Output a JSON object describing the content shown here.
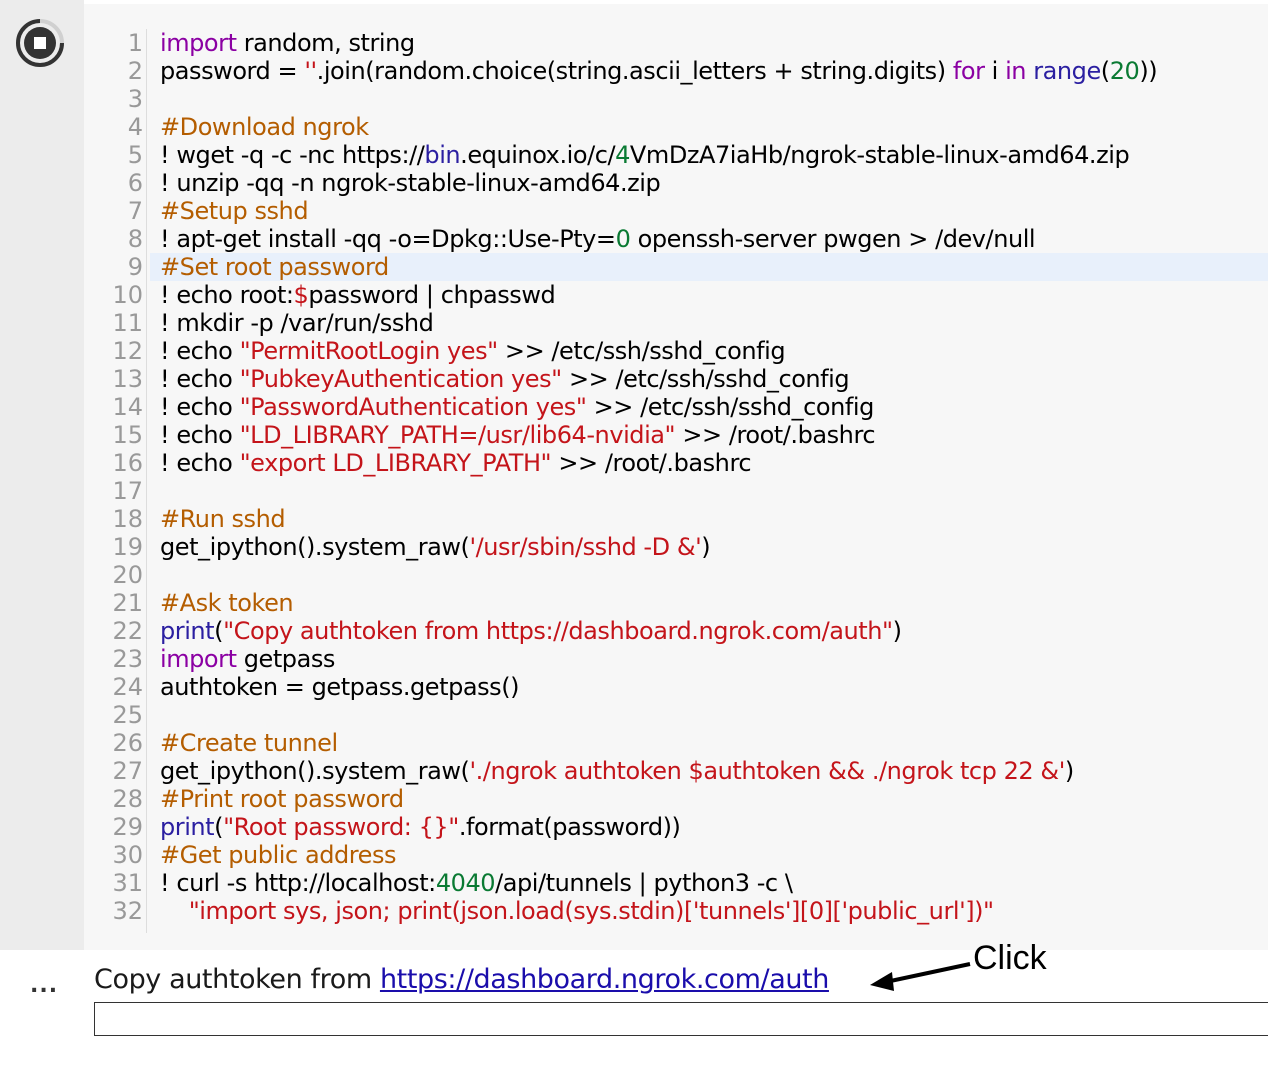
{
  "cell": {
    "lines": [
      [
        {
          "t": "import",
          "c": "kw"
        },
        {
          "t": " random, string",
          "c": ""
        }
      ],
      [
        {
          "t": "password = ",
          "c": ""
        },
        {
          "t": "''",
          "c": "st"
        },
        {
          "t": ".join(random.choice(string.ascii_letters + string.digits) ",
          "c": ""
        },
        {
          "t": "for",
          "c": "kw"
        },
        {
          "t": " i ",
          "c": ""
        },
        {
          "t": "in",
          "c": "kw"
        },
        {
          "t": " ",
          "c": ""
        },
        {
          "t": "range",
          "c": "bi"
        },
        {
          "t": "(",
          "c": ""
        },
        {
          "t": "20",
          "c": "nm"
        },
        {
          "t": "))",
          "c": ""
        }
      ],
      [],
      [
        {
          "t": "#Download ngrok",
          "c": "cm"
        }
      ],
      [
        {
          "t": "! wget -q -c -nc https://",
          "c": ""
        },
        {
          "t": "bin",
          "c": "bi"
        },
        {
          "t": ".equinox.io/c/",
          "c": ""
        },
        {
          "t": "4",
          "c": "nm"
        },
        {
          "t": "VmDzA7iaHb/ngrok-stable-linux-amd64.zip",
          "c": ""
        }
      ],
      [
        {
          "t": "! unzip -qq -n ngrok-stable-linux-amd64.zip",
          "c": ""
        }
      ],
      [
        {
          "t": "#Setup sshd",
          "c": "cm"
        }
      ],
      [
        {
          "t": "! apt-get install -qq -o=Dpkg::Use-Pty=",
          "c": ""
        },
        {
          "t": "0",
          "c": "nm"
        },
        {
          "t": " openssh-server pwgen > /dev/null",
          "c": ""
        }
      ],
      [
        {
          "t": "#Set root password",
          "c": "cm"
        }
      ],
      [
        {
          "t": "! echo root:",
          "c": ""
        },
        {
          "t": "$",
          "c": "st"
        },
        {
          "t": "password | chpasswd",
          "c": ""
        }
      ],
      [
        {
          "t": "! mkdir -p /var/run/sshd",
          "c": ""
        }
      ],
      [
        {
          "t": "! echo ",
          "c": ""
        },
        {
          "t": "\"PermitRootLogin yes\"",
          "c": "st"
        },
        {
          "t": " >> /etc/ssh/sshd_config",
          "c": ""
        }
      ],
      [
        {
          "t": "! echo ",
          "c": ""
        },
        {
          "t": "\"PubkeyAuthentication yes\"",
          "c": "st"
        },
        {
          "t": " >> /etc/ssh/sshd_config",
          "c": ""
        }
      ],
      [
        {
          "t": "! echo ",
          "c": ""
        },
        {
          "t": "\"PasswordAuthentication yes\"",
          "c": "st"
        },
        {
          "t": " >> /etc/ssh/sshd_config",
          "c": ""
        }
      ],
      [
        {
          "t": "! echo ",
          "c": ""
        },
        {
          "t": "\"LD_LIBRARY_PATH=/usr/lib64-nvidia\"",
          "c": "st"
        },
        {
          "t": " >> /root/.bashrc",
          "c": ""
        }
      ],
      [
        {
          "t": "! echo ",
          "c": ""
        },
        {
          "t": "\"export LD_LIBRARY_PATH\"",
          "c": "st"
        },
        {
          "t": " >> /root/.bashrc",
          "c": ""
        }
      ],
      [],
      [
        {
          "t": "#Run sshd",
          "c": "cm"
        }
      ],
      [
        {
          "t": "get_ipython().system_raw(",
          "c": ""
        },
        {
          "t": "'/usr/sbin/sshd -D &'",
          "c": "st"
        },
        {
          "t": ")",
          "c": ""
        }
      ],
      [],
      [
        {
          "t": "#Ask token",
          "c": "cm"
        }
      ],
      [
        {
          "t": "print",
          "c": "bi"
        },
        {
          "t": "(",
          "c": ""
        },
        {
          "t": "\"Copy authtoken from https://dashboard.ngrok.com/auth\"",
          "c": "st"
        },
        {
          "t": ")",
          "c": ""
        }
      ],
      [
        {
          "t": "import",
          "c": "kw"
        },
        {
          "t": " getpass",
          "c": ""
        }
      ],
      [
        {
          "t": "authtoken = getpass.getpass()",
          "c": ""
        }
      ],
      [],
      [
        {
          "t": "#Create tunnel",
          "c": "cm"
        }
      ],
      [
        {
          "t": "get_ipython().system_raw(",
          "c": ""
        },
        {
          "t": "'./ngrok authtoken $authtoken && ./ngrok tcp 22 &'",
          "c": "st"
        },
        {
          "t": ")",
          "c": ""
        }
      ],
      [
        {
          "t": "#Print root password",
          "c": "cm"
        }
      ],
      [
        {
          "t": "print",
          "c": "bi"
        },
        {
          "t": "(",
          "c": ""
        },
        {
          "t": "\"Root password: {}\"",
          "c": "st"
        },
        {
          "t": ".format(password))",
          "c": ""
        }
      ],
      [
        {
          "t": "#Get public address",
          "c": "cm"
        }
      ],
      [
        {
          "t": "! curl -s http://localhost:",
          "c": ""
        },
        {
          "t": "4040",
          "c": "nm"
        },
        {
          "t": "/api/tunnels | python3 -c \\",
          "c": ""
        }
      ],
      [
        {
          "t": "    \"import sys, json; print(json.load(sys.stdin)['tunnels'][0]['public_url'])\"",
          "c": "st"
        }
      ]
    ],
    "highlighted_line": 9,
    "run_button_icon": "stop-icon"
  },
  "output": {
    "indicator": "...",
    "prefix": "Copy authtoken from ",
    "link": "https://dashboard.ngrok.com/auth",
    "input_value": ""
  },
  "annotation": {
    "label": "Click",
    "arrow_icon": "arrow-left-icon"
  },
  "colors": {
    "keyword": "#8b00a3",
    "builtin": "#2b1fa1",
    "comment": "#b45d00",
    "string": "#c4141a",
    "number": "#0a7a33",
    "link": "#1a0dab"
  }
}
